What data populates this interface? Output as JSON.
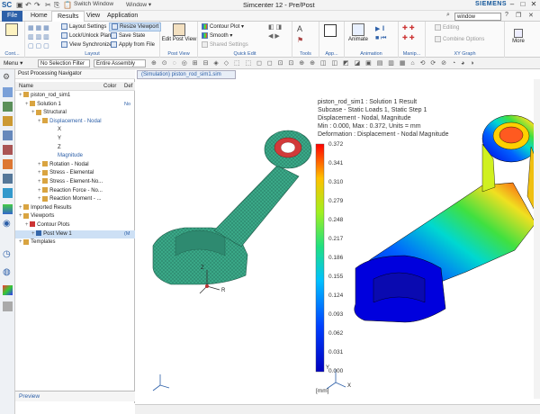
{
  "titlebar": {
    "app_abbr": "SC",
    "switch_window": "Switch Window",
    "window_menu": "Window ▾",
    "title": "Simcenter 12 - Pre/Post",
    "brand": "SIEMENS"
  },
  "ribbon_tabs": [
    {
      "label": "File"
    },
    {
      "label": "Home"
    },
    {
      "label": "Results"
    },
    {
      "label": "View"
    },
    {
      "label": "Application"
    }
  ],
  "search": {
    "value": "window"
  },
  "ribbon": {
    "cont_label": "Cont...",
    "layout": {
      "label": "Layout",
      "settings": "Layout Settings",
      "lock": "Lock/Unlock Plane",
      "sync": "View Synchronize",
      "resize": "Resize Viewport",
      "save_state": "Save State",
      "apply_file": "Apply from File"
    },
    "post_view": {
      "label": "Post View",
      "edit": "Edit Post View"
    },
    "quick_edit": {
      "label": "Quick Edit",
      "contour": "Contour Plot",
      "smooth": "Smooth",
      "shared": "Shared Settings"
    },
    "tools": {
      "label": "Tools"
    },
    "app": {
      "label": "App..."
    },
    "animation": {
      "label": "Animation",
      "animate": "Animate"
    },
    "manip": {
      "label": "Manip..."
    },
    "xy_graph": {
      "label": "XY Graph",
      "editing": "Editing",
      "combine": "Combine Options"
    },
    "more": "More"
  },
  "selection_bar": {
    "menu": "Menu ▾",
    "filter": "No Selection Filter",
    "assembly": "Entire Assembly"
  },
  "navigator": {
    "title": "Post Processing Navigator",
    "columns": {
      "name": "Name",
      "color": "Color",
      "def": "Def"
    },
    "rows": [
      {
        "label": "piston_rod_sim1",
        "indent": 0,
        "col3": ""
      },
      {
        "label": "Solution 1",
        "indent": 1,
        "col3": "No"
      },
      {
        "label": "Structural",
        "indent": 2,
        "col3": ""
      },
      {
        "label": "Displacement - Nodal",
        "indent": 3,
        "col3": "",
        "selected": true
      },
      {
        "label": "X",
        "indent": 5,
        "col3": ""
      },
      {
        "label": "Y",
        "indent": 5,
        "col3": ""
      },
      {
        "label": "Z",
        "indent": 5,
        "col3": ""
      },
      {
        "label": "Magnitude",
        "indent": 5,
        "col3": ""
      },
      {
        "label": "Rotation - Nodal",
        "indent": 3,
        "col3": ""
      },
      {
        "label": "Stress - Elemental",
        "indent": 3,
        "col3": ""
      },
      {
        "label": "Stress - Element-No...",
        "indent": 3,
        "col3": ""
      },
      {
        "label": "Reaction Force - No...",
        "indent": 3,
        "col3": ""
      },
      {
        "label": "Reaction Moment - ...",
        "indent": 3,
        "col3": ""
      },
      {
        "label": "Imported Results",
        "indent": 0,
        "col3": ""
      },
      {
        "label": "Viewports",
        "indent": 0,
        "col3": ""
      },
      {
        "label": "Contour Plots",
        "indent": 1,
        "col3": ""
      },
      {
        "label": "Post View 1",
        "indent": 2,
        "col3": "(M",
        "highlight": true
      },
      {
        "label": "Templates",
        "indent": 0,
        "col3": ""
      }
    ],
    "preview": "Preview"
  },
  "graphics": {
    "tab": "(Simulation) piston_rod_sim1.sim",
    "info": [
      "piston_rod_sim1 : Solution 1 Result",
      "Subcase - Static Loads 1, Static Step 1",
      "Displacement - Nodal, Magnitude",
      "Min : 0.000, Max : 0.372, Units = mm",
      "Deformation : Displacement - Nodal Magnitude"
    ],
    "legend": [
      "0.372",
      "0.341",
      "0.310",
      "0.279",
      "0.248",
      "0.217",
      "0.186",
      "0.155",
      "0.124",
      "0.093",
      "0.062",
      "0.031",
      "0.000"
    ],
    "unit": "[mm]",
    "triad": {
      "x": "X",
      "y": "Y",
      "z": "Z",
      "r": "R"
    }
  }
}
